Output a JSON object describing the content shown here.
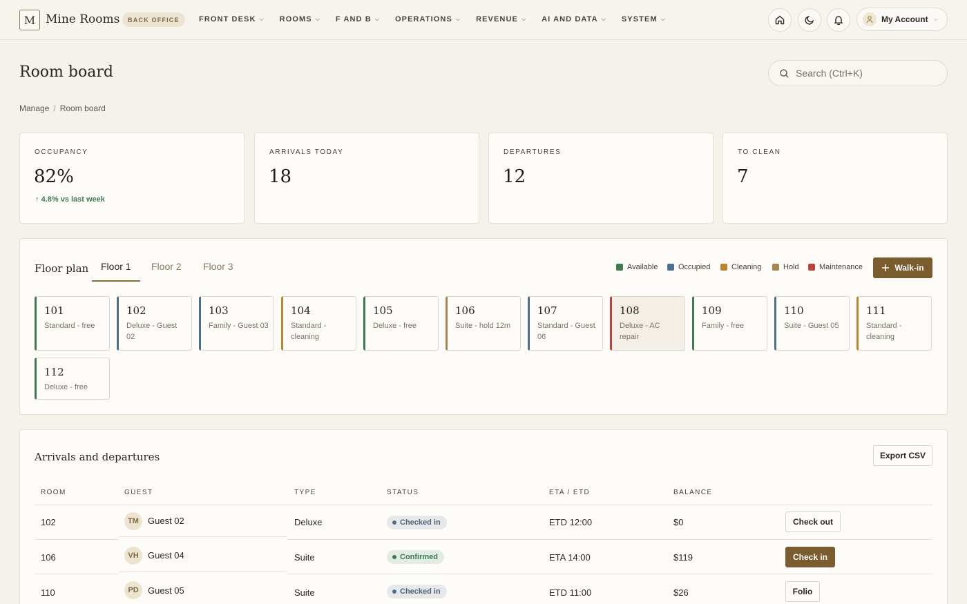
{
  "app": {
    "logo_letter": "M",
    "brand": "Mine Rooms",
    "badge": "BACK OFFICE",
    "nav": [
      {
        "label": "FRONT DESK"
      },
      {
        "label": "ROOMS"
      },
      {
        "label": "F AND B"
      },
      {
        "label": "OPERATIONS"
      },
      {
        "label": "REVENUE"
      },
      {
        "label": "AI AND DATA"
      },
      {
        "label": "SYSTEM"
      }
    ],
    "account_label": "My Account"
  },
  "page": {
    "title": "Room board",
    "search_placeholder": "Search (Ctrl+K)",
    "breadcrumb": [
      "Manage",
      "Room board"
    ],
    "breadcrumb_sep": "/"
  },
  "kpis": [
    {
      "label": "OCCUPANCY",
      "value": "82%",
      "trend": "4.8% vs last week"
    },
    {
      "label": "ARRIVALS TODAY",
      "value": "18"
    },
    {
      "label": "DEPARTURES",
      "value": "12"
    },
    {
      "label": "TO CLEAN",
      "value": "7"
    }
  ],
  "floor_plan": {
    "title": "Floor plan",
    "tabs": [
      "Floor 1",
      "Floor 2",
      "Floor 3"
    ],
    "active_tab": "Floor 1",
    "legend": [
      {
        "label": "Available",
        "color": "#3d7a4f"
      },
      {
        "label": "Occupied",
        "color": "#4f6f8f"
      },
      {
        "label": "Cleaning",
        "color": "#b8862e"
      },
      {
        "label": "Hold",
        "color": "#a8864f"
      },
      {
        "label": "Maintenance",
        "color": "#b8443a"
      }
    ],
    "walkin_label": "Walk-in",
    "rooms": [
      {
        "number": "101",
        "desc": "Standard - free",
        "status": "Available"
      },
      {
        "number": "102",
        "desc": "Deluxe - Guest 02",
        "status": "Occupied"
      },
      {
        "number": "103",
        "desc": "Family - Guest 03",
        "status": "Occupied"
      },
      {
        "number": "104",
        "desc": "Standard - cleaning",
        "status": "Cleaning"
      },
      {
        "number": "105",
        "desc": "Deluxe - free",
        "status": "Available"
      },
      {
        "number": "106",
        "desc": "Suite - hold 12m",
        "status": "Hold"
      },
      {
        "number": "107",
        "desc": "Standard - Guest 06",
        "status": "Occupied"
      },
      {
        "number": "108",
        "desc": "Deluxe - AC repair",
        "status": "Maintenance"
      },
      {
        "number": "109",
        "desc": "Family - free",
        "status": "Available"
      },
      {
        "number": "110",
        "desc": "Suite - Guest 05",
        "status": "Occupied"
      },
      {
        "number": "111",
        "desc": "Standard - cleaning",
        "status": "Cleaning"
      },
      {
        "number": "112",
        "desc": "Deluxe - free",
        "status": "Available"
      }
    ]
  },
  "arrivals": {
    "title": "Arrivals and departures",
    "export_label": "Export CSV",
    "columns": [
      "ROOM",
      "GUEST",
      "TYPE",
      "STATUS",
      "ETA / ETD",
      "BALANCE"
    ],
    "rows": [
      {
        "room": "102",
        "initials": "TM",
        "guest": "Guest 02",
        "type": "Deluxe",
        "status": "Checked in",
        "eta": "ETD 12:00",
        "balance": "$0",
        "action": "Check out"
      },
      {
        "room": "106",
        "initials": "VH",
        "guest": "Guest 04",
        "type": "Suite",
        "status": "Confirmed",
        "eta": "ETA 14:00",
        "balance": "$119",
        "action": "Check in"
      },
      {
        "room": "110",
        "initials": "PD",
        "guest": "Guest 05",
        "type": "Suite",
        "status": "Checked in",
        "eta": "ETD 11:00",
        "balance": "$26",
        "action": "Folio"
      }
    ]
  }
}
